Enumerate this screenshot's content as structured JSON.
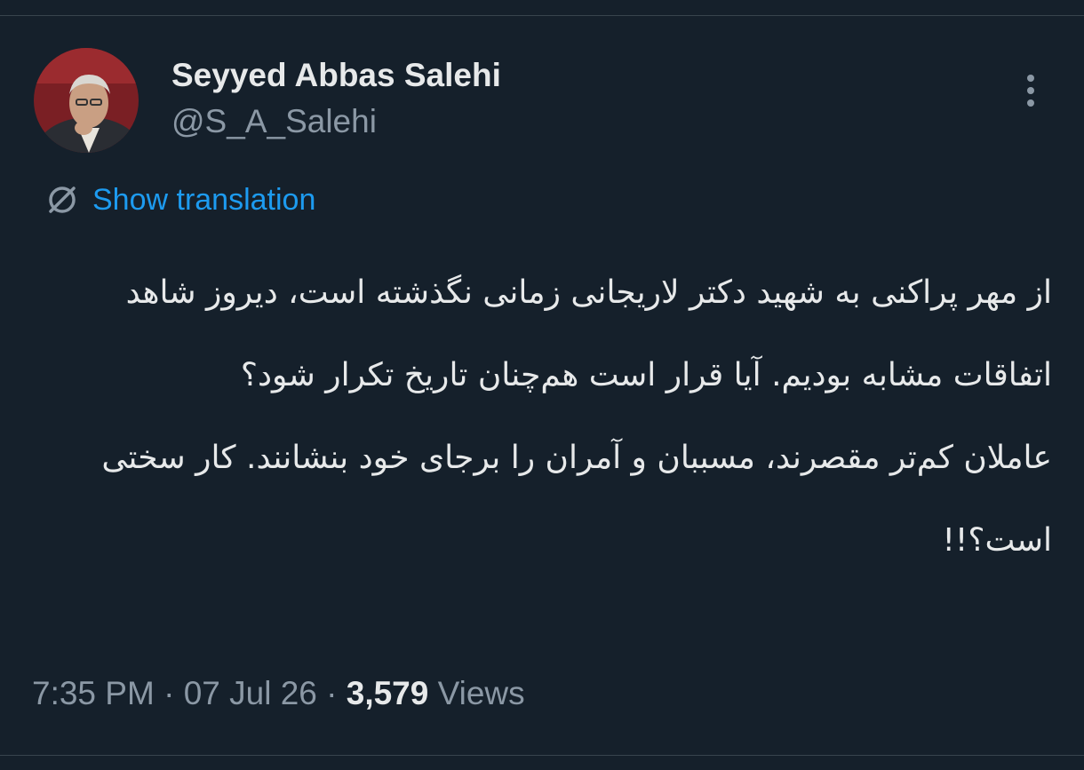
{
  "author": {
    "display_name": "Seyyed Abbas Salehi",
    "handle": "@S_A_Salehi",
    "avatar_icon": "user-avatar-photo"
  },
  "translate": {
    "label": "Show translation",
    "icon": "translate-globe-icon"
  },
  "more_icon": "more-vertical-icon",
  "tweet": {
    "paragraphs": [
      "از مهر پراکنی به شهید دکتر لاریجانی زمانی نگذشته است، دیروز شاهد اتفاقات مشابه بودیم. آیا قرار است هم‌چنان تاریخ تکرار شود؟",
      "عاملان کم‌تر مقصرند، مسببان و آمران را برجای خود بنشانند. کار سختی است؟!!"
    ]
  },
  "meta": {
    "time": "7:35 PM",
    "separator": "·",
    "date": "07 Jul 26",
    "views_count": "3,579",
    "views_label": "Views"
  },
  "colors": {
    "background": "#15202b",
    "primary_text": "#e7e9ea",
    "secondary_text": "#8b98a5",
    "link": "#1d9bf0",
    "divider": "#38444d"
  }
}
